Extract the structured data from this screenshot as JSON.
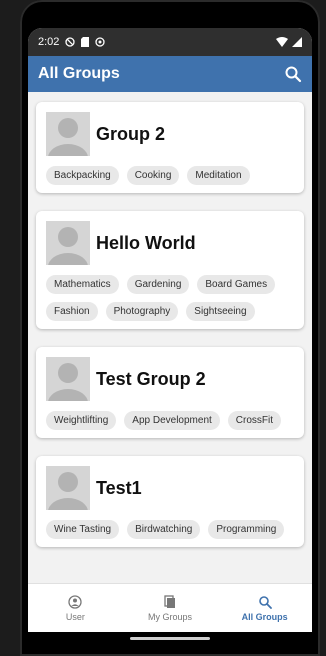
{
  "status_bar": {
    "time": "2:02"
  },
  "app_bar": {
    "title": "All Groups"
  },
  "groups": [
    {
      "name": "Group 2",
      "tags": [
        "Backpacking",
        "Cooking",
        "Meditation"
      ]
    },
    {
      "name": "Hello World",
      "tags": [
        "Mathematics",
        "Gardening",
        "Board Games",
        "Fashion",
        "Photography",
        "Sightseeing"
      ]
    },
    {
      "name": "Test Group 2",
      "tags": [
        "Weightlifting",
        "App Development",
        "CrossFit"
      ]
    },
    {
      "name": "Test1",
      "tags": [
        "Wine Tasting",
        "Birdwatching",
        "Programming"
      ]
    }
  ],
  "bottom_nav": {
    "items": [
      {
        "label": "User",
        "icon": "user-icon"
      },
      {
        "label": "My Groups",
        "icon": "groups-icon"
      },
      {
        "label": "All Groups",
        "icon": "search-icon",
        "active": true
      }
    ]
  },
  "colors": {
    "accent": "#3f72ad",
    "tag_bg": "#e8e8e8"
  }
}
